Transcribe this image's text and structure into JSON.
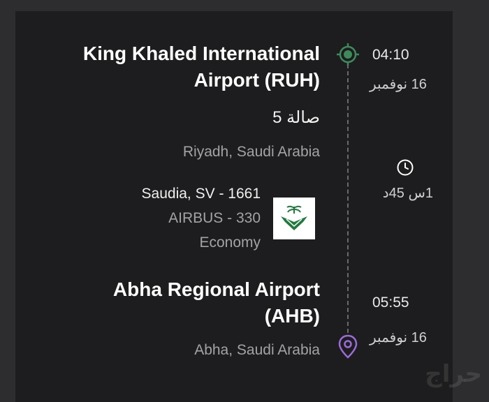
{
  "departure": {
    "airport_line1": "King Khaled International",
    "airport_line2": "Airport (RUH)",
    "terminal": "صالة 5",
    "city": "Riyadh, Saudi Arabia",
    "time": "04:10",
    "date": "16 نوفمبر",
    "icon": "target-icon"
  },
  "duration": {
    "text": "1س 45د",
    "icon": "clock-icon"
  },
  "flight": {
    "airline_number": "Saudia, SV - 1661",
    "aircraft": "AIRBUS - 330",
    "cabin": "Economy",
    "logo": "saudia-logo"
  },
  "arrival": {
    "airport_line1": "Abha Regional Airport",
    "airport_line2": "(AHB)",
    "city": "Abha, Saudi Arabia",
    "time": "05:55",
    "date": "16 نوفمبر",
    "icon": "location-pin-icon"
  },
  "watermark": "حراج",
  "colors": {
    "background": "#1d1d1f",
    "departure_icon": "#3f8a5a",
    "arrival_icon": "#9b6bd6",
    "saudia_green": "#1f7a3c"
  }
}
